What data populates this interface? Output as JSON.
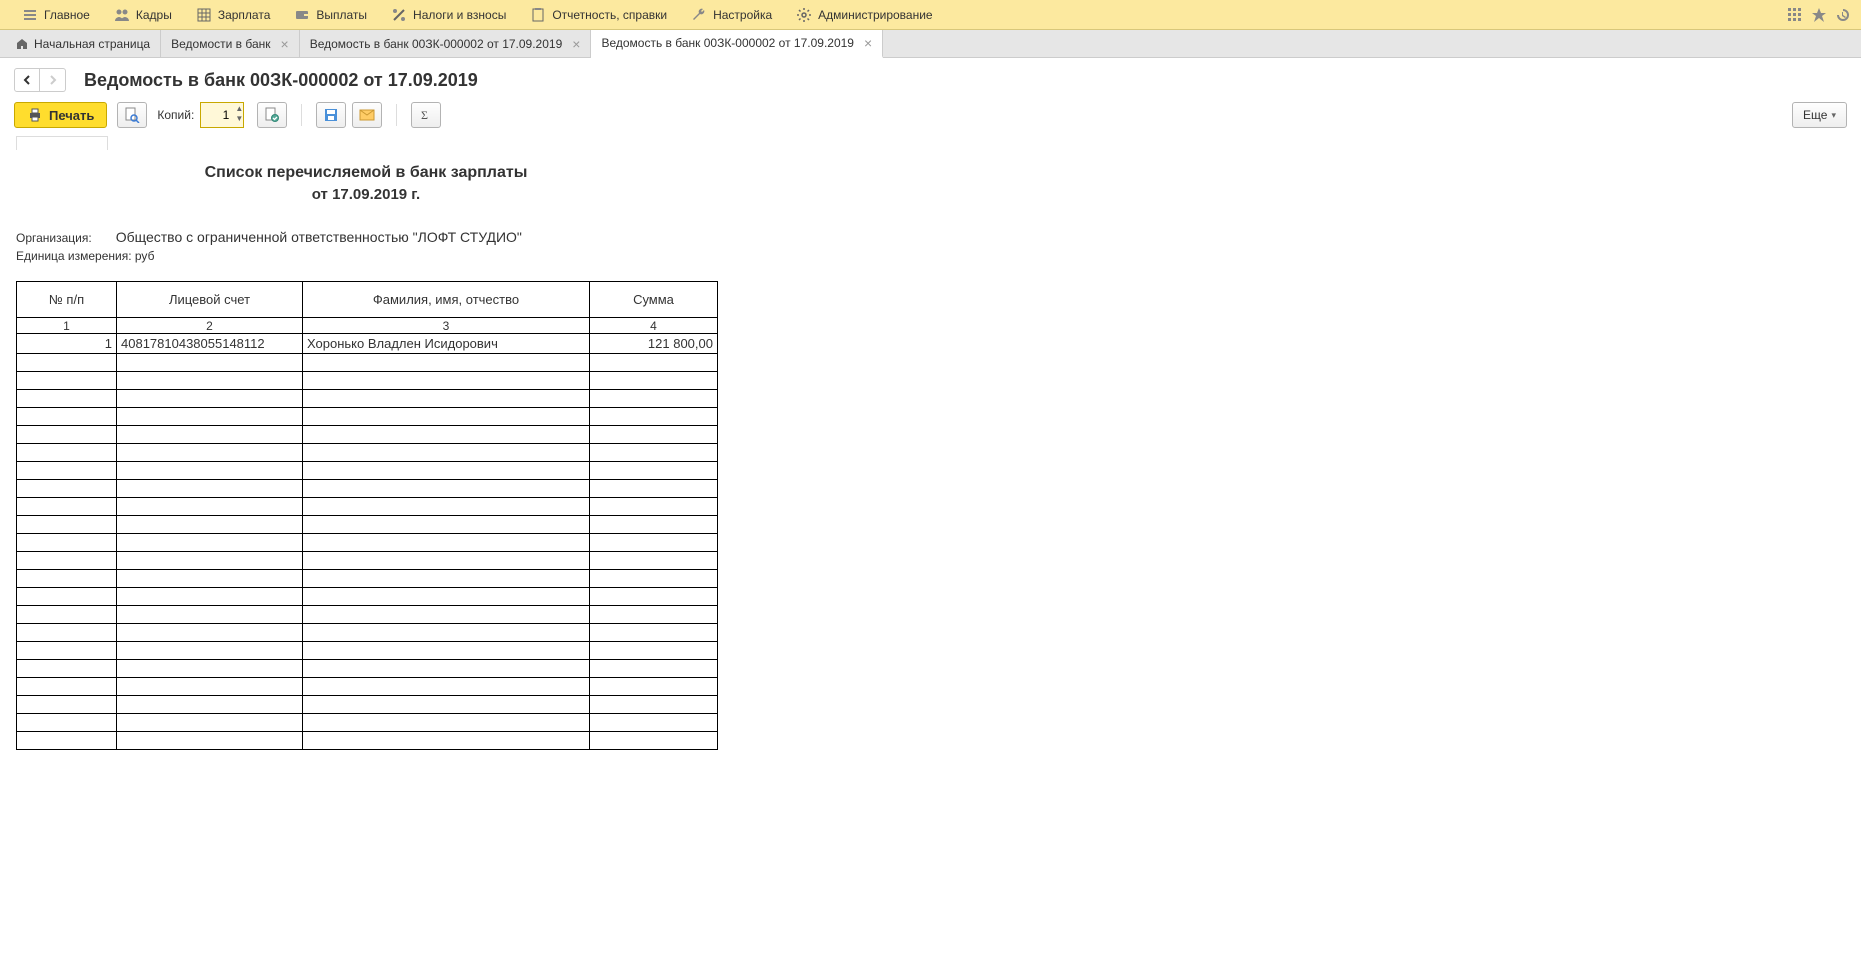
{
  "topbar": {
    "items": [
      {
        "icon": "menu",
        "label": "Главное"
      },
      {
        "icon": "users",
        "label": "Кадры"
      },
      {
        "icon": "table",
        "label": "Зарплата"
      },
      {
        "icon": "wallet",
        "label": "Выплаты"
      },
      {
        "icon": "percent",
        "label": "Налоги и взносы"
      },
      {
        "icon": "clipboard",
        "label": "Отчетность, справки"
      },
      {
        "icon": "wrench",
        "label": "Настройка"
      },
      {
        "icon": "gear",
        "label": "Администрирование"
      }
    ]
  },
  "tabs": [
    {
      "label": "Начальная страница",
      "closable": false,
      "home": true
    },
    {
      "label": "Ведомости в банк",
      "closable": true
    },
    {
      "label": "Ведомость в банк 00ЗК-000002 от 17.09.2019",
      "closable": true
    },
    {
      "label": "Ведомость в банк 00ЗК-000002 от 17.09.2019",
      "closable": true,
      "active": true
    }
  ],
  "page": {
    "title": "Ведомость в банк 00ЗК-000002 от 17.09.2019"
  },
  "toolbar": {
    "print_label": "Печать",
    "copies_label": "Копий:",
    "copies_value": "1",
    "more_label": "Еще"
  },
  "document": {
    "heading1": "Список перечисляемой в банк зарплаты",
    "heading2": "от 17.09.2019 г.",
    "org_label": "Организация:",
    "org_value": "Общество с ограниченной ответственностью \"ЛОФТ СТУДИО\"",
    "unit_label": "Единица измерения: руб",
    "columns": {
      "n": "№ п/п",
      "account": "Лицевой счет",
      "fio": "Фамилия, имя, отчество",
      "sum": "Сумма"
    },
    "colnums": {
      "n": "1",
      "account": "2",
      "fio": "3",
      "sum": "4"
    },
    "rows": [
      {
        "n": "1",
        "account": "40817810438055148112",
        "fio": "Хоронько Владлен Исидорович",
        "sum": "121 800,00"
      }
    ],
    "empty_rows": 22
  }
}
